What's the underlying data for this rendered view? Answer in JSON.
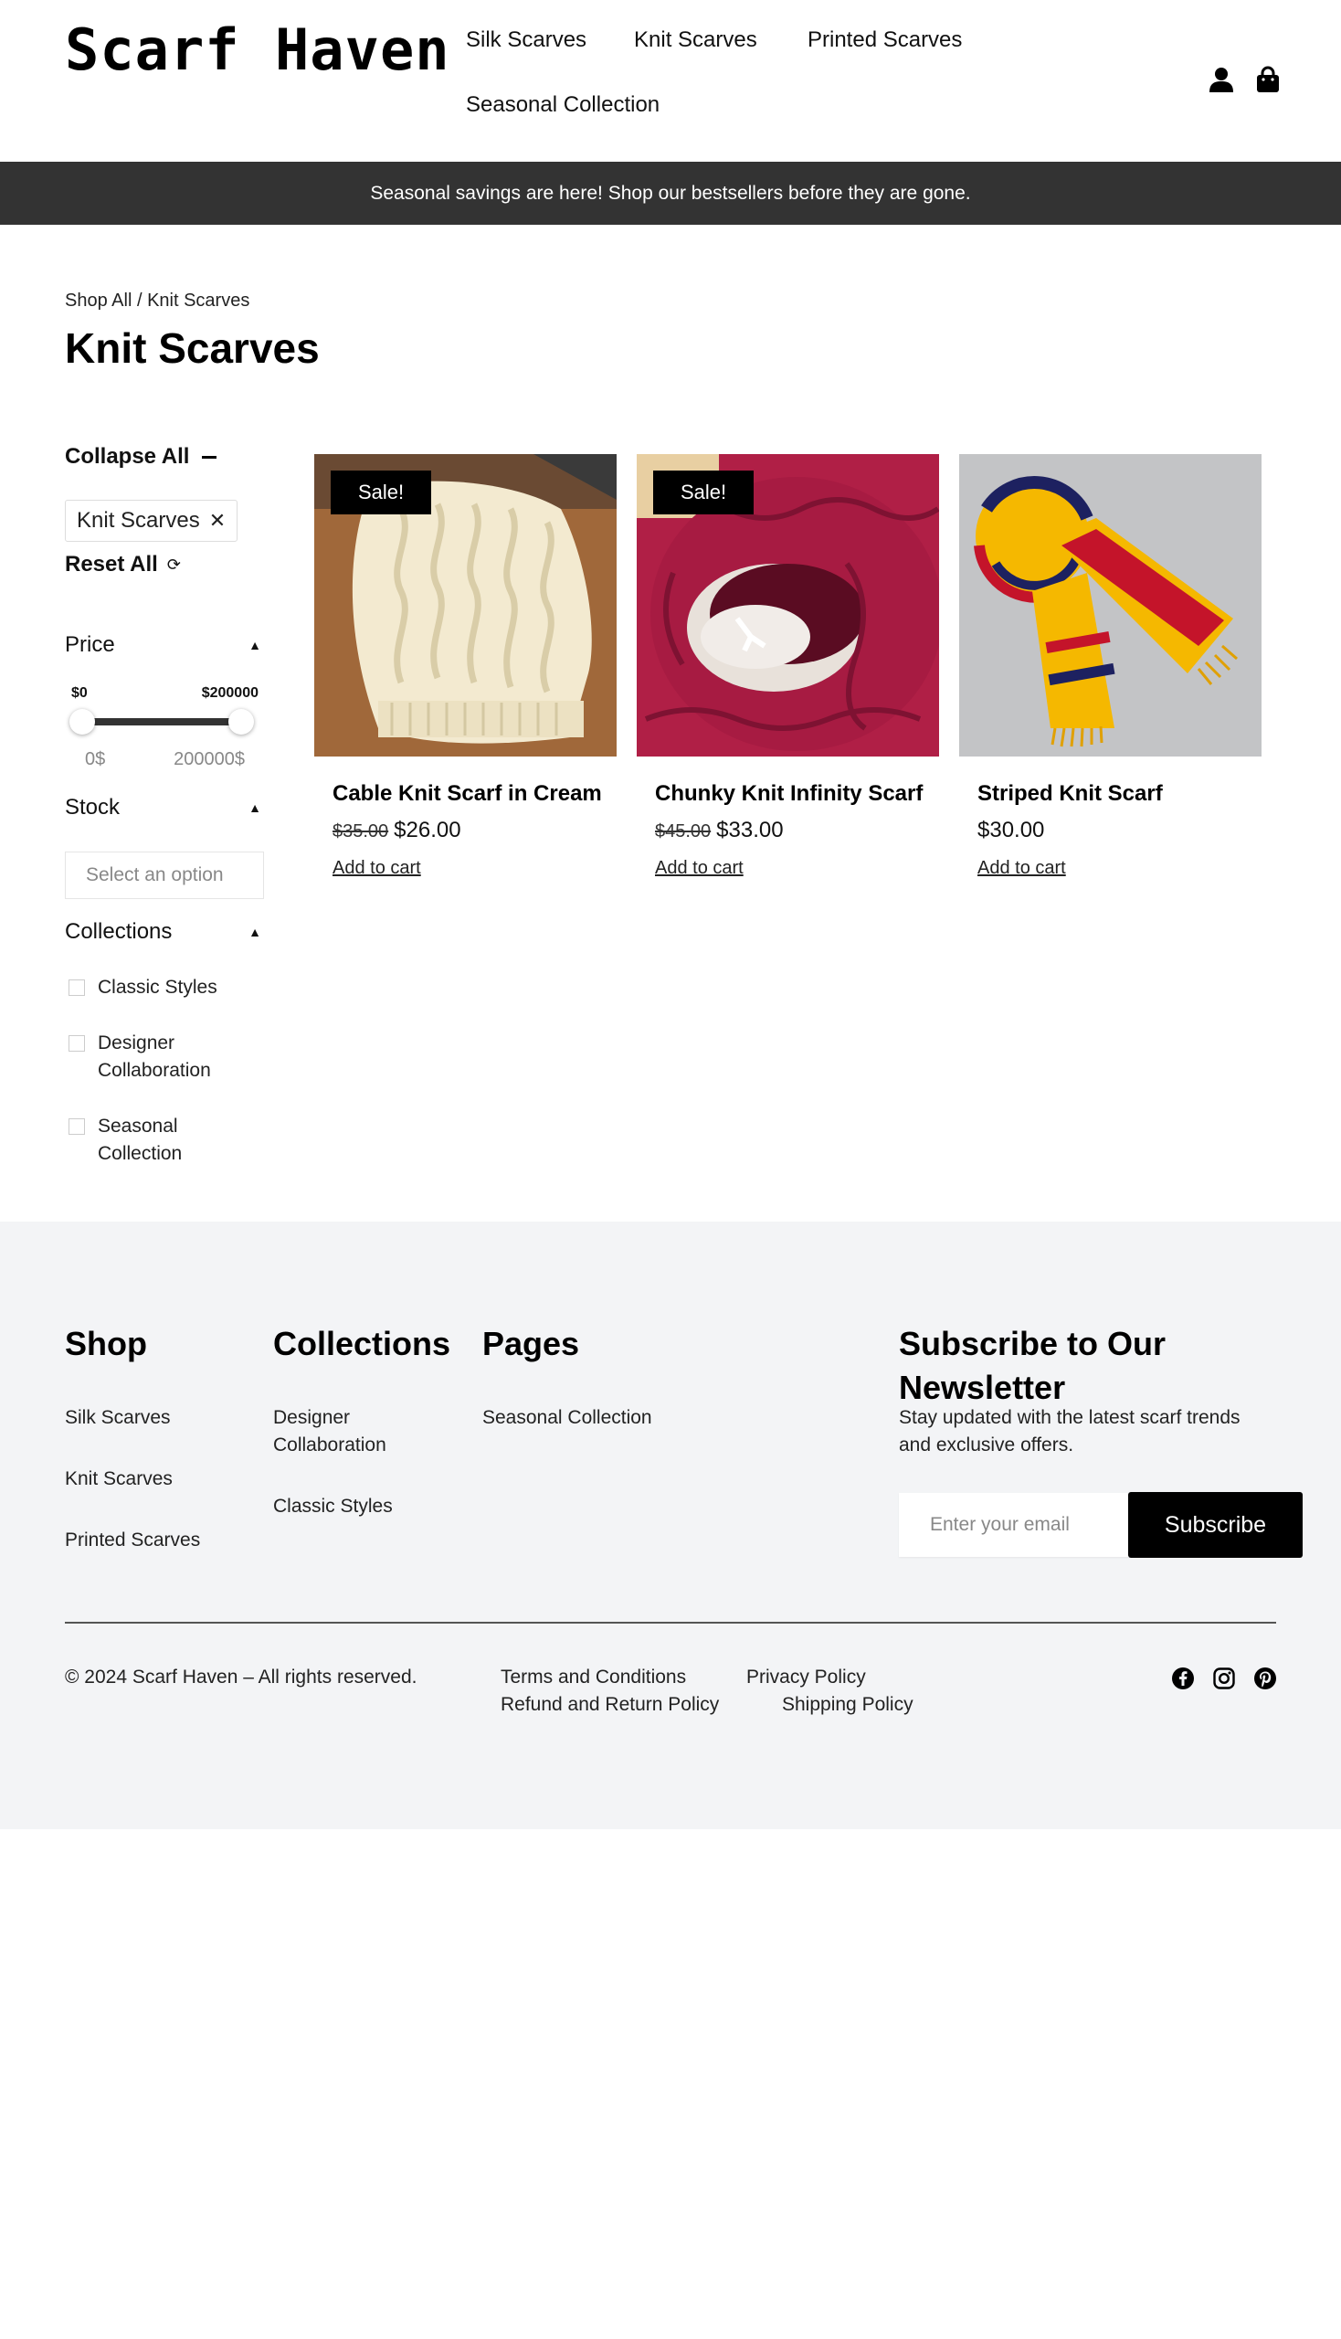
{
  "header": {
    "logo": "Scarf Haven",
    "nav": [
      "Silk Scarves",
      "Knit Scarves",
      "Printed Scarves",
      "Seasonal Collection"
    ],
    "icons": [
      "account-icon",
      "shopping-bag-icon"
    ]
  },
  "announcement": "Seasonal savings are here! Shop our bestsellers before they are gone.",
  "breadcrumb": {
    "root": "Shop All",
    "separator": " / ",
    "current": "Knit Scarves"
  },
  "page_title": "Knit Scarves",
  "filters": {
    "collapse_all": "Collapse All",
    "active_chip": "Knit Scarves",
    "reset_all": "Reset All",
    "price": {
      "label": "Price",
      "min_label": "$0",
      "max_label": "$200000",
      "range_min": "0$",
      "range_max": "200000$",
      "selected_min_fraction": 0,
      "selected_max_fraction": 1
    },
    "stock": {
      "label": "Stock",
      "placeholder": "Select an option"
    },
    "collections": {
      "label": "Collections",
      "options": [
        {
          "label1": "Classic Styles",
          "label2": ""
        },
        {
          "label1": "Designer",
          "label2": "Collaboration"
        },
        {
          "label1": "Seasonal",
          "label2": "Collection"
        }
      ]
    }
  },
  "products": [
    {
      "name": "Cable Knit Scarf in Cream",
      "badge": "Sale!",
      "old_price": "$35.00",
      "price": "$26.00",
      "cta": "Add to cart"
    },
    {
      "name": "Chunky Knit Infinity Scarf",
      "badge": "Sale!",
      "old_price": "$45.00",
      "price": "$33.00",
      "cta": "Add to cart"
    },
    {
      "name": "Striped Knit Scarf",
      "badge": "",
      "old_price": "",
      "price": "$30.00",
      "cta": "Add to cart"
    }
  ],
  "footer": {
    "shop": {
      "title": "Shop",
      "links": [
        "Silk Scarves",
        "Knit Scarves",
        "Printed Scarves"
      ]
    },
    "collections": {
      "title": "Collections",
      "link1a": "Designer",
      "link1b": "Collaboration",
      "link2": "Classic Styles"
    },
    "pages": {
      "title": "Pages",
      "links": [
        "Seasonal Collection"
      ]
    },
    "newsletter": {
      "title1": "Subscribe to Our",
      "title2": "Newsletter",
      "text1": "Stay updated with the latest scarf trends",
      "text2": "and exclusive offers.",
      "placeholder": "Enter your email",
      "button": "Subscribe"
    },
    "copyright": "© 2024 Scarf Haven – All rights reserved.",
    "legal": [
      "Terms and Conditions",
      "Privacy Policy",
      "Refund and Return Policy",
      "Shipping Policy"
    ],
    "social": [
      "facebook-icon",
      "instagram-icon",
      "pinterest-icon"
    ]
  },
  "colors": {
    "announcement_bg": "#333333",
    "footer_bg": "#f3f4f6",
    "badge_bg": "#000000",
    "button_bg": "#000000"
  }
}
